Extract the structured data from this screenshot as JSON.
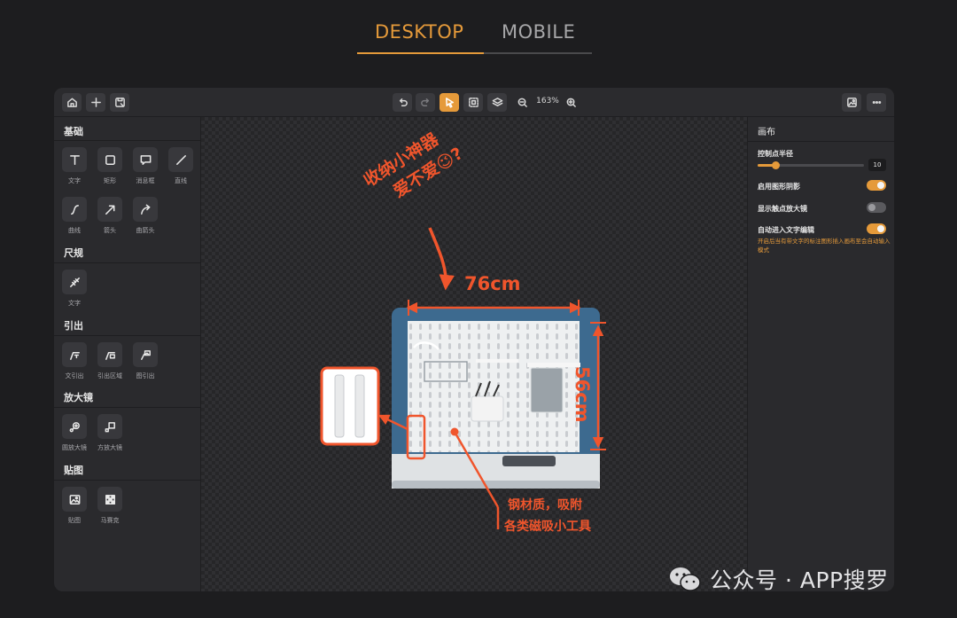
{
  "tabs": {
    "desktop": "DESKTOP",
    "mobile": "MOBILE",
    "active": "desktop"
  },
  "toolbar": {
    "zoom": "163%",
    "left_icons": [
      "home-icon",
      "plus-icon",
      "save-icon"
    ],
    "center_icons": [
      "undo-icon",
      "redo-icon",
      "pointer-icon",
      "select-area-icon",
      "layers-icon",
      "zoom-out-icon",
      "zoom-in-icon"
    ],
    "right_icons": [
      "export-image-icon",
      "more-icon"
    ]
  },
  "left_panel": {
    "sections": [
      {
        "title": "基础",
        "tools": [
          "文字",
          "矩形",
          "消息框",
          "直线",
          "曲线",
          "箭头",
          "曲箭头"
        ]
      },
      {
        "title": "尺规",
        "tools": [
          "文字"
        ]
      },
      {
        "title": "引出",
        "tools": [
          "文引出",
          "引出区域",
          "图引出"
        ]
      },
      {
        "title": "放大镜",
        "tools": [
          "圆放大镜",
          "方放大镜"
        ]
      },
      {
        "title": "贴图",
        "tools": [
          "贴图",
          "马赛克"
        ]
      }
    ]
  },
  "canvas": {
    "annotation_top_line1": "收纳小神器",
    "annotation_top_line2": "爱不爱",
    "emoji": "😉",
    "question_mark": "?",
    "width_label": "76cm",
    "height_label": "56cm",
    "bottom_line1": "钢材质，吸附",
    "bottom_line2": "各类磁吸小工具"
  },
  "right_panel": {
    "title": "画布",
    "radius_label": "控制点半径",
    "radius_value": "10",
    "radius_fraction": 0.17,
    "shadow_label": "启用图形阴影",
    "shadow_on": true,
    "magnifier_label": "显示触点放大镜",
    "magnifier_on": false,
    "auto_edit_label": "自动进入文字编辑",
    "auto_edit_on": true,
    "hint": "开启后当有带文字的标注图形插入画布至会自动输入模式"
  },
  "watermark": {
    "text": "公众号 · APP搜罗"
  },
  "colors": {
    "accent": "#e59a3a",
    "annotation": "#f0552c",
    "panel": "#2a2a2d"
  }
}
